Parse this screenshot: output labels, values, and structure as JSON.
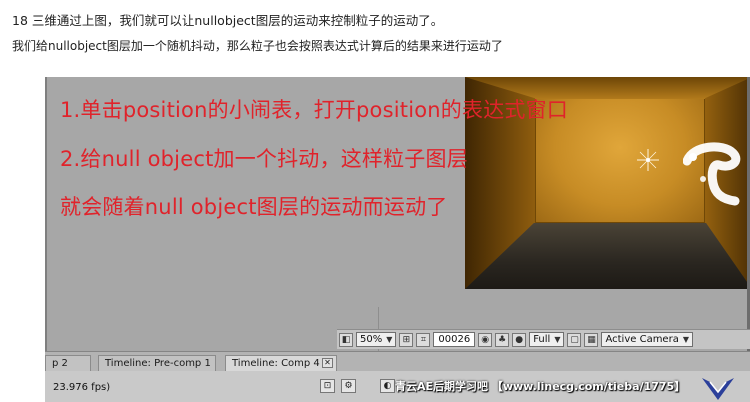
{
  "captions": {
    "line1": "18 三维通过上图，我们就可以让nullobject图层的运动来控制粒子的运动了。",
    "line2": "我们给nullobject图层加一个随机抖动，那么粒子也会按照表达式计算后的结果来进行运动了"
  },
  "annotations": {
    "line1": "1.单击position的小闹表，打开position的表达式窗口",
    "line2": "2.给null object加一个抖动，这样粒子图层",
    "line3": "就会随着null object图层的运动而运动了"
  },
  "viewer_toolbar": {
    "zoom": "50%",
    "timecode": "00026",
    "resolution": "Full",
    "view": "Active Camera"
  },
  "tabs": [
    {
      "label": "p 2"
    },
    {
      "label": "Timeline: Pre-comp 1"
    },
    {
      "label": "Timeline: Comp 4"
    }
  ],
  "status": {
    "fps": "23.976 fps)"
  },
  "watermark": "青云AE后期学习吧  【www.linecg.com/tieba/1775】",
  "colors": {
    "annotation": "#e0232b",
    "panel": "#a7a7a7",
    "viewport_wall": "#c98a1d"
  }
}
